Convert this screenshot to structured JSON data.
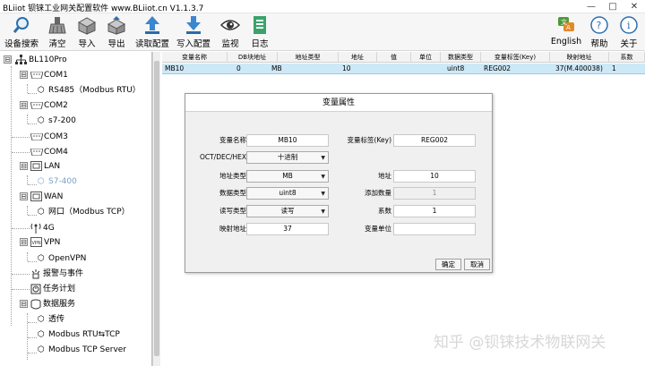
{
  "window": {
    "title": "BLiiot  钡铼工业网关配置软件 www.BLiiot.cn V1.1.3.7",
    "controls": [
      "—",
      "□",
      "✕"
    ]
  },
  "toolbar": {
    "left": [
      {
        "label": "设备搜索",
        "icon": "search-icon"
      },
      {
        "label": "清空",
        "icon": "broom-icon"
      },
      {
        "label": "导入",
        "icon": "import-box-icon"
      },
      {
        "label": "导出",
        "icon": "export-box-icon"
      },
      {
        "label": "读取配置",
        "icon": "upload-arrow-icon"
      },
      {
        "label": "写入配置",
        "icon": "download-arrow-icon"
      },
      {
        "label": "监视",
        "icon": "eye-icon"
      },
      {
        "label": "日志",
        "icon": "log-document-icon"
      }
    ],
    "right": [
      {
        "label": "English",
        "icon": "language-icon"
      },
      {
        "label": "帮助",
        "icon": "help-icon"
      },
      {
        "label": "关于",
        "icon": "info-icon"
      }
    ]
  },
  "tree": [
    {
      "label": "BL110Pro",
      "level": 0,
      "expander": "⊟",
      "icon": "network-tree-icon"
    },
    {
      "label": "COM1",
      "level": 1,
      "expander": "⊟",
      "icon": "serial-port-icon"
    },
    {
      "label": "RS485（Modbus RTU）",
      "level": 2,
      "icon": "cube-icon"
    },
    {
      "label": "COM2",
      "level": 1,
      "expander": "⊟",
      "icon": "serial-port-icon"
    },
    {
      "label": "s7-200",
      "level": 2,
      "icon": "cube-icon"
    },
    {
      "label": "COM3",
      "level": 1,
      "icon": "serial-port-icon"
    },
    {
      "label": "COM4",
      "level": 1,
      "icon": "serial-port-icon"
    },
    {
      "label": "LAN",
      "level": 1,
      "expander": "⊟",
      "icon": "lan-icon"
    },
    {
      "label": "S7-400",
      "level": 2,
      "icon": "cube-icon",
      "selected": true
    },
    {
      "label": "WAN",
      "level": 1,
      "expander": "⊟",
      "icon": "lan-icon"
    },
    {
      "label": "网口（Modbus TCP）",
      "level": 2,
      "icon": "cube-icon"
    },
    {
      "label": "4G",
      "level": 1,
      "icon": "antenna-icon"
    },
    {
      "label": "VPN",
      "level": 1,
      "expander": "⊟",
      "icon": "vpn-icon"
    },
    {
      "label": "OpenVPN",
      "level": 2,
      "icon": "cube-icon"
    },
    {
      "label": "报警与事件",
      "level": 1,
      "icon": "alarm-icon"
    },
    {
      "label": "任务计划",
      "level": 1,
      "icon": "task-icon"
    },
    {
      "label": "数据服务",
      "level": 1,
      "expander": "⊟",
      "icon": "data-service-icon"
    },
    {
      "label": "透传",
      "level": 2,
      "icon": "cube-icon"
    },
    {
      "label": "Modbus RTU⇆TCP",
      "level": 2,
      "icon": "cube-icon"
    },
    {
      "label": "Modbus TCP Server",
      "level": 2,
      "icon": "cube-icon"
    }
  ],
  "table": {
    "columns": [
      "变量名称",
      "DB块地址",
      "地址类型",
      "地址",
      "值",
      "单位",
      "数据类型",
      "变量标签(Key)",
      "映射地址",
      "系数"
    ],
    "rows": [
      [
        "MB10",
        "0",
        "MB",
        "10",
        "",
        "",
        "uint8",
        "REG002",
        "37(M.400038)",
        "1"
      ]
    ]
  },
  "dialog": {
    "title": "变量属性",
    "fields": {
      "var_name": {
        "label": "变量名称",
        "value": "MB10"
      },
      "var_key": {
        "label": "变量标签(Key)",
        "value": "REG002"
      },
      "base": {
        "label": "OCT/DEC/HEX",
        "value": "十进制"
      },
      "addr_type": {
        "label": "地址类型",
        "value": "MB"
      },
      "address": {
        "label": "地址",
        "value": "10"
      },
      "data_type": {
        "label": "数据类型",
        "value": "uint8"
      },
      "add_count": {
        "label": "添加数量",
        "value": "1"
      },
      "rw_type": {
        "label": "读写类型",
        "value": "读写"
      },
      "coef": {
        "label": "系数",
        "value": "1"
      },
      "map_addr": {
        "label": "映射地址",
        "value": "37"
      },
      "var_unit": {
        "label": "变量单位",
        "value": ""
      }
    },
    "ok_label": "确定",
    "cancel_label": "取消"
  },
  "watermark": "知乎 @钡铼技术物联网关",
  "colors": {
    "selected_row": "#cde8f6",
    "selected_tree_text": "#7aa0c8",
    "toolbar_bg": "#f6f6f6"
  }
}
